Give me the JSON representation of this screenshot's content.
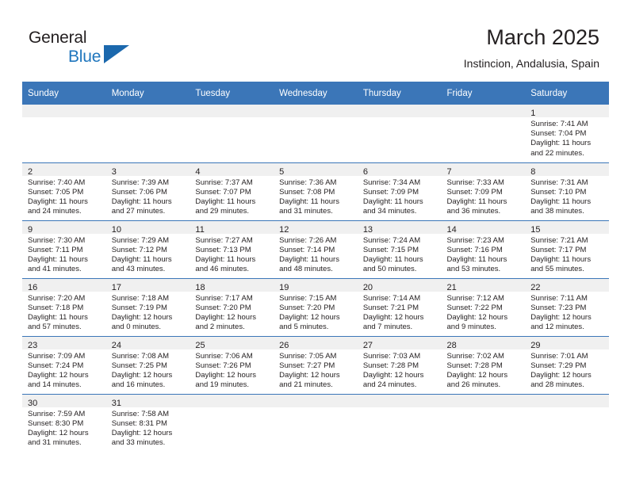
{
  "brand": {
    "word1": "General",
    "word2": "Blue",
    "accent_color": "#1b68ad"
  },
  "header": {
    "title": "March 2025",
    "subtitle": "Instincion, Andalusia, Spain"
  },
  "calendar": {
    "header_bg": "#3b76b8",
    "daynum_bg": "#f0f0f0",
    "weekday_headers": [
      "Sunday",
      "Monday",
      "Tuesday",
      "Wednesday",
      "Thursday",
      "Friday",
      "Saturday"
    ],
    "weeks": [
      [
        {
          "day": "",
          "lines": []
        },
        {
          "day": "",
          "lines": []
        },
        {
          "day": "",
          "lines": []
        },
        {
          "day": "",
          "lines": []
        },
        {
          "day": "",
          "lines": []
        },
        {
          "day": "",
          "lines": []
        },
        {
          "day": "1",
          "lines": [
            "Sunrise: 7:41 AM",
            "Sunset: 7:04 PM",
            "Daylight: 11 hours",
            "and 22 minutes."
          ]
        }
      ],
      [
        {
          "day": "2",
          "lines": [
            "Sunrise: 7:40 AM",
            "Sunset: 7:05 PM",
            "Daylight: 11 hours",
            "and 24 minutes."
          ]
        },
        {
          "day": "3",
          "lines": [
            "Sunrise: 7:39 AM",
            "Sunset: 7:06 PM",
            "Daylight: 11 hours",
            "and 27 minutes."
          ]
        },
        {
          "day": "4",
          "lines": [
            "Sunrise: 7:37 AM",
            "Sunset: 7:07 PM",
            "Daylight: 11 hours",
            "and 29 minutes."
          ]
        },
        {
          "day": "5",
          "lines": [
            "Sunrise: 7:36 AM",
            "Sunset: 7:08 PM",
            "Daylight: 11 hours",
            "and 31 minutes."
          ]
        },
        {
          "day": "6",
          "lines": [
            "Sunrise: 7:34 AM",
            "Sunset: 7:09 PM",
            "Daylight: 11 hours",
            "and 34 minutes."
          ]
        },
        {
          "day": "7",
          "lines": [
            "Sunrise: 7:33 AM",
            "Sunset: 7:09 PM",
            "Daylight: 11 hours",
            "and 36 minutes."
          ]
        },
        {
          "day": "8",
          "lines": [
            "Sunrise: 7:31 AM",
            "Sunset: 7:10 PM",
            "Daylight: 11 hours",
            "and 38 minutes."
          ]
        }
      ],
      [
        {
          "day": "9",
          "lines": [
            "Sunrise: 7:30 AM",
            "Sunset: 7:11 PM",
            "Daylight: 11 hours",
            "and 41 minutes."
          ]
        },
        {
          "day": "10",
          "lines": [
            "Sunrise: 7:29 AM",
            "Sunset: 7:12 PM",
            "Daylight: 11 hours",
            "and 43 minutes."
          ]
        },
        {
          "day": "11",
          "lines": [
            "Sunrise: 7:27 AM",
            "Sunset: 7:13 PM",
            "Daylight: 11 hours",
            "and 46 minutes."
          ]
        },
        {
          "day": "12",
          "lines": [
            "Sunrise: 7:26 AM",
            "Sunset: 7:14 PM",
            "Daylight: 11 hours",
            "and 48 minutes."
          ]
        },
        {
          "day": "13",
          "lines": [
            "Sunrise: 7:24 AM",
            "Sunset: 7:15 PM",
            "Daylight: 11 hours",
            "and 50 minutes."
          ]
        },
        {
          "day": "14",
          "lines": [
            "Sunrise: 7:23 AM",
            "Sunset: 7:16 PM",
            "Daylight: 11 hours",
            "and 53 minutes."
          ]
        },
        {
          "day": "15",
          "lines": [
            "Sunrise: 7:21 AM",
            "Sunset: 7:17 PM",
            "Daylight: 11 hours",
            "and 55 minutes."
          ]
        }
      ],
      [
        {
          "day": "16",
          "lines": [
            "Sunrise: 7:20 AM",
            "Sunset: 7:18 PM",
            "Daylight: 11 hours",
            "and 57 minutes."
          ]
        },
        {
          "day": "17",
          "lines": [
            "Sunrise: 7:18 AM",
            "Sunset: 7:19 PM",
            "Daylight: 12 hours",
            "and 0 minutes."
          ]
        },
        {
          "day": "18",
          "lines": [
            "Sunrise: 7:17 AM",
            "Sunset: 7:20 PM",
            "Daylight: 12 hours",
            "and 2 minutes."
          ]
        },
        {
          "day": "19",
          "lines": [
            "Sunrise: 7:15 AM",
            "Sunset: 7:20 PM",
            "Daylight: 12 hours",
            "and 5 minutes."
          ]
        },
        {
          "day": "20",
          "lines": [
            "Sunrise: 7:14 AM",
            "Sunset: 7:21 PM",
            "Daylight: 12 hours",
            "and 7 minutes."
          ]
        },
        {
          "day": "21",
          "lines": [
            "Sunrise: 7:12 AM",
            "Sunset: 7:22 PM",
            "Daylight: 12 hours",
            "and 9 minutes."
          ]
        },
        {
          "day": "22",
          "lines": [
            "Sunrise: 7:11 AM",
            "Sunset: 7:23 PM",
            "Daylight: 12 hours",
            "and 12 minutes."
          ]
        }
      ],
      [
        {
          "day": "23",
          "lines": [
            "Sunrise: 7:09 AM",
            "Sunset: 7:24 PM",
            "Daylight: 12 hours",
            "and 14 minutes."
          ]
        },
        {
          "day": "24",
          "lines": [
            "Sunrise: 7:08 AM",
            "Sunset: 7:25 PM",
            "Daylight: 12 hours",
            "and 16 minutes."
          ]
        },
        {
          "day": "25",
          "lines": [
            "Sunrise: 7:06 AM",
            "Sunset: 7:26 PM",
            "Daylight: 12 hours",
            "and 19 minutes."
          ]
        },
        {
          "day": "26",
          "lines": [
            "Sunrise: 7:05 AM",
            "Sunset: 7:27 PM",
            "Daylight: 12 hours",
            "and 21 minutes."
          ]
        },
        {
          "day": "27",
          "lines": [
            "Sunrise: 7:03 AM",
            "Sunset: 7:28 PM",
            "Daylight: 12 hours",
            "and 24 minutes."
          ]
        },
        {
          "day": "28",
          "lines": [
            "Sunrise: 7:02 AM",
            "Sunset: 7:28 PM",
            "Daylight: 12 hours",
            "and 26 minutes."
          ]
        },
        {
          "day": "29",
          "lines": [
            "Sunrise: 7:01 AM",
            "Sunset: 7:29 PM",
            "Daylight: 12 hours",
            "and 28 minutes."
          ]
        }
      ],
      [
        {
          "day": "30",
          "lines": [
            "Sunrise: 7:59 AM",
            "Sunset: 8:30 PM",
            "Daylight: 12 hours",
            "and 31 minutes."
          ]
        },
        {
          "day": "31",
          "lines": [
            "Sunrise: 7:58 AM",
            "Sunset: 8:31 PM",
            "Daylight: 12 hours",
            "and 33 minutes."
          ]
        },
        {
          "day": "",
          "lines": []
        },
        {
          "day": "",
          "lines": []
        },
        {
          "day": "",
          "lines": []
        },
        {
          "day": "",
          "lines": []
        },
        {
          "day": "",
          "lines": []
        }
      ]
    ]
  }
}
